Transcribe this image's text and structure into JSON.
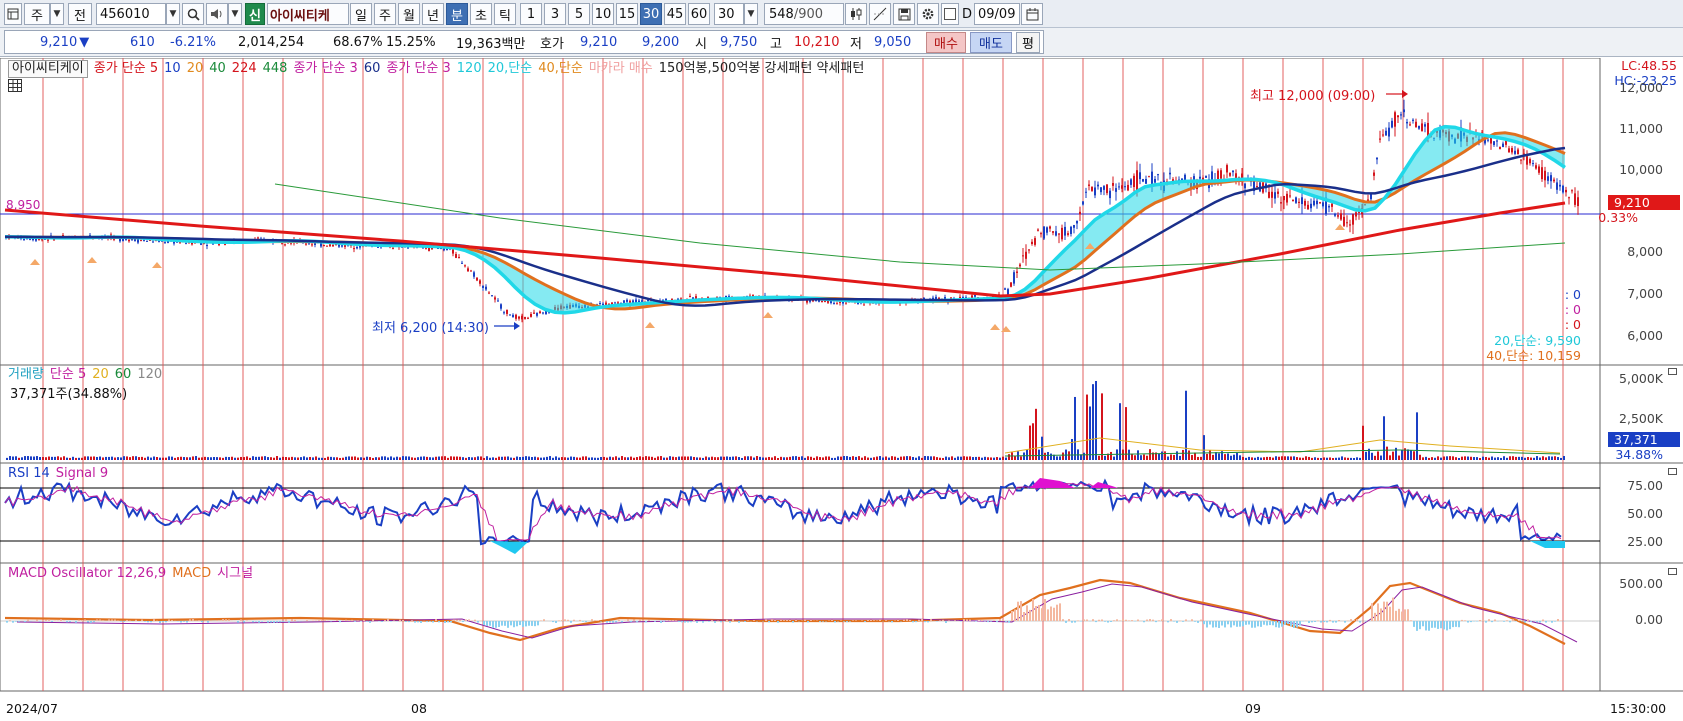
{
  "toolbar": {
    "period_type": "주",
    "prev_label": "전",
    "code": "456010",
    "new_badge": "신",
    "stock_name": "아이씨티케",
    "tabs": [
      "일",
      "주",
      "월",
      "년",
      "분",
      "초",
      "틱"
    ],
    "active_tab": "분",
    "intervals": [
      "1",
      "3",
      "5",
      "10",
      "15",
      "30",
      "45",
      "60"
    ],
    "active_interval": "30",
    "interval_value": "30",
    "count_value": "548",
    "count_total": "/900",
    "date_check_label": "D",
    "date_value": "09/09"
  },
  "quote": {
    "price": "9,210",
    "change_symbol": "▼",
    "change": "610",
    "change_pct": "-6.21%",
    "volume": "2,014,254",
    "vol_ratio": "68.67%",
    "turnover": "15.25%",
    "amount": "19,363백만",
    "bidask_label": "호가",
    "ask": "9,210",
    "bid": "9,200",
    "open_label": "시",
    "open": "9,750",
    "high_label": "고",
    "high": "10,210",
    "low_label": "저",
    "low": "9,050",
    "buy_label": "매수",
    "sell_label": "매도",
    "eval_label": "평"
  },
  "price_panel": {
    "legend_name": "아이씨티케이",
    "legend_items": [
      {
        "text": "종가 단순 5",
        "color": "#d4141c"
      },
      {
        "text": "10",
        "color": "#1a3fc4"
      },
      {
        "text": "20",
        "color": "#e08a1e"
      },
      {
        "text": "40",
        "color": "#1a8a3a"
      },
      {
        "text": "224",
        "color": "#d4141c"
      },
      {
        "text": "448",
        "color": "#1a8a3a"
      },
      {
        "text": "종가 단순 3",
        "color": "#c020a0"
      },
      {
        "text": "60",
        "color": "#1a2f8a"
      },
      {
        "text": "종가 단순 3",
        "color": "#c020a0"
      },
      {
        "text": "120",
        "color": "#20c8d8"
      },
      {
        "text": "20,단순",
        "color": "#20c8d8"
      },
      {
        "text": "40,단순",
        "color": "#e08a1e"
      },
      {
        "text": "마카라 매수",
        "color": "#f0a0a0"
      },
      {
        "text": "150억봉,500억봉 강세패턴  약세패턴",
        "color": "#222222"
      }
    ],
    "lc_label": "LC:48.55",
    "hc_label": "HC:-23.25",
    "y_ticks": [
      "12,000",
      "11,000",
      "10,000",
      "8,000",
      "7,000",
      "6,000"
    ],
    "last_price_tag": "9,210",
    "last_pct_tag": "0.33%",
    "ref_line_label": "8,950",
    "high_annotation": "최고 12,000 (09:00)",
    "low_annotation": "최저 6,200 (14:30)",
    "zero_labels": [
      ": 0",
      ": 0",
      ": 0"
    ],
    "ma20_label": "20,단순: 9,590",
    "ma40_label": "40,단순: 10,159"
  },
  "volume_panel": {
    "legend": [
      {
        "text": "거래량",
        "color": "#20a0c0"
      },
      {
        "text": "단순 5",
        "color": "#c020a0"
      },
      {
        "text": "20",
        "color": "#e0b020"
      },
      {
        "text": "60",
        "color": "#1a8a3a"
      },
      {
        "text": "120",
        "color": "#888888"
      }
    ],
    "sub_label": "37,371주(34.88%)",
    "y_ticks": [
      "5,000K",
      "2,500K"
    ],
    "last_tag": "37,371",
    "last_pct": "34.88%"
  },
  "rsi_panel": {
    "legend": [
      {
        "text": "RSI 14",
        "color": "#1a3fc4"
      },
      {
        "text": "Signal 9",
        "color": "#c020a0"
      }
    ],
    "y_ticks": [
      "75.00",
      "50.00",
      "25.00"
    ]
  },
  "macd_panel": {
    "legend": [
      {
        "text": "MACD Oscillator 12,26,9",
        "color": "#c020a0"
      },
      {
        "text": "MACD",
        "color": "#e0701e"
      },
      {
        "text": "시그널",
        "color": "#c020a0"
      }
    ],
    "y_ticks": [
      "500.00",
      "0.00"
    ]
  },
  "x_axis": {
    "labels": [
      "2024/07",
      "08",
      "09"
    ],
    "time_label": "15:30:00"
  },
  "colors": {
    "up": "#d4141c",
    "down": "#1a3fc4",
    "ma_cyan": "#20d8e8",
    "ma_orange": "#e0701e",
    "ma_navy": "#1a2f8a",
    "ma_red": "#e01818",
    "grid_red": "#e05050"
  }
}
